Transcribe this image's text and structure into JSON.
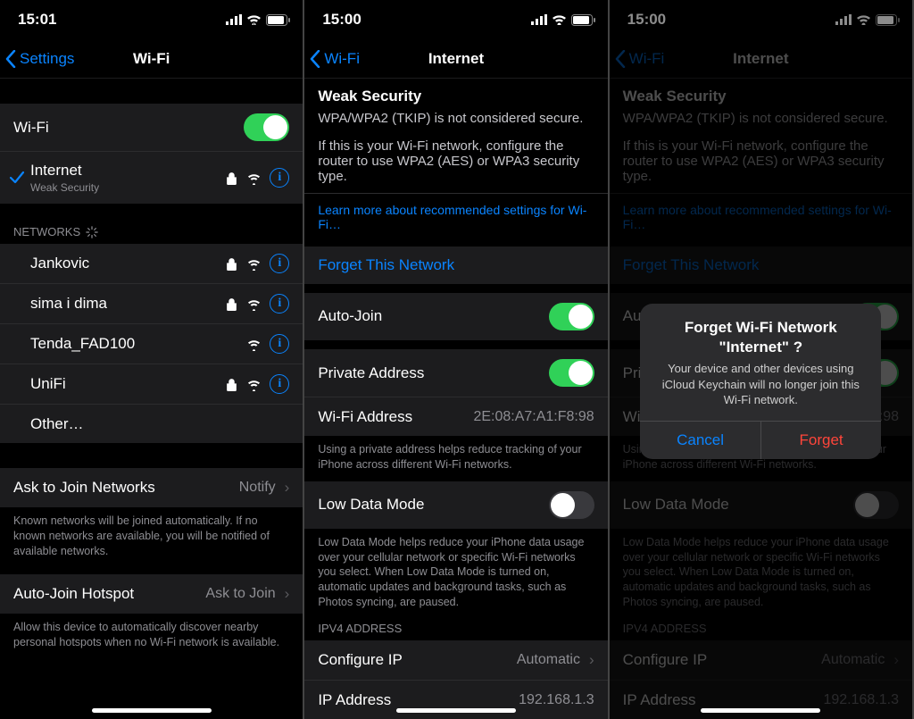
{
  "screens": {
    "wifi": {
      "time": "15:01",
      "back": "Settings",
      "title": "Wi-Fi",
      "wifi_label": "Wi-Fi",
      "wifi_on": true,
      "connected": {
        "name": "Internet",
        "sub": "Weak Security",
        "locked": true
      },
      "networks_header": "NETWORKS",
      "networks": [
        {
          "name": "Jankovic",
          "locked": true
        },
        {
          "name": "sima i dima",
          "locked": true
        },
        {
          "name": "Tenda_FAD100",
          "locked": false
        },
        {
          "name": "UniFi",
          "locked": true
        },
        {
          "name": "Other…",
          "other": true
        }
      ],
      "ask_label": "Ask to Join Networks",
      "ask_value": "Notify",
      "ask_footer": "Known networks will be joined automatically. If no known networks are available, you will be notified of available networks.",
      "hotspot_label": "Auto-Join Hotspot",
      "hotspot_value": "Ask to Join",
      "hotspot_footer": "Allow this device to automatically discover nearby personal hotspots when no Wi-Fi network is available."
    },
    "detail": {
      "time": "15:00",
      "back": "Wi-Fi",
      "title": "Internet",
      "weak_title": "Weak Security",
      "weak_line1": "WPA/WPA2 (TKIP) is not considered secure.",
      "weak_line2": "If this is your Wi-Fi network, configure the router to use WPA2 (AES) or WPA3 security type.",
      "learn_more": "Learn more about recommended settings for Wi-Fi…",
      "forget": "Forget This Network",
      "autojoin_label": "Auto-Join",
      "private_label": "Private Address",
      "wifi_addr_label": "Wi-Fi Address",
      "wifi_addr_value": "2E:08:A7:A1:F8:98",
      "private_footer": "Using a private address helps reduce tracking of your iPhone across different Wi-Fi networks.",
      "lowdata_label": "Low Data Mode",
      "lowdata_footer": "Low Data Mode helps reduce your iPhone data usage over your cellular network or specific Wi-Fi networks you select. When Low Data Mode is turned on, automatic updates and background tasks, such as Photos syncing, are paused.",
      "ipv4_header": "IPV4 ADDRESS",
      "configip_label": "Configure IP",
      "configip_value": "Automatic",
      "ipaddr_label": "IP Address",
      "ipaddr_value": "192.168.1.3"
    },
    "alert": {
      "title": "Forget Wi-Fi Network \"Internet\" ?",
      "msg": "Your device and other devices using iCloud Keychain will no longer join this Wi-Fi network.",
      "cancel": "Cancel",
      "forget": "Forget"
    }
  }
}
